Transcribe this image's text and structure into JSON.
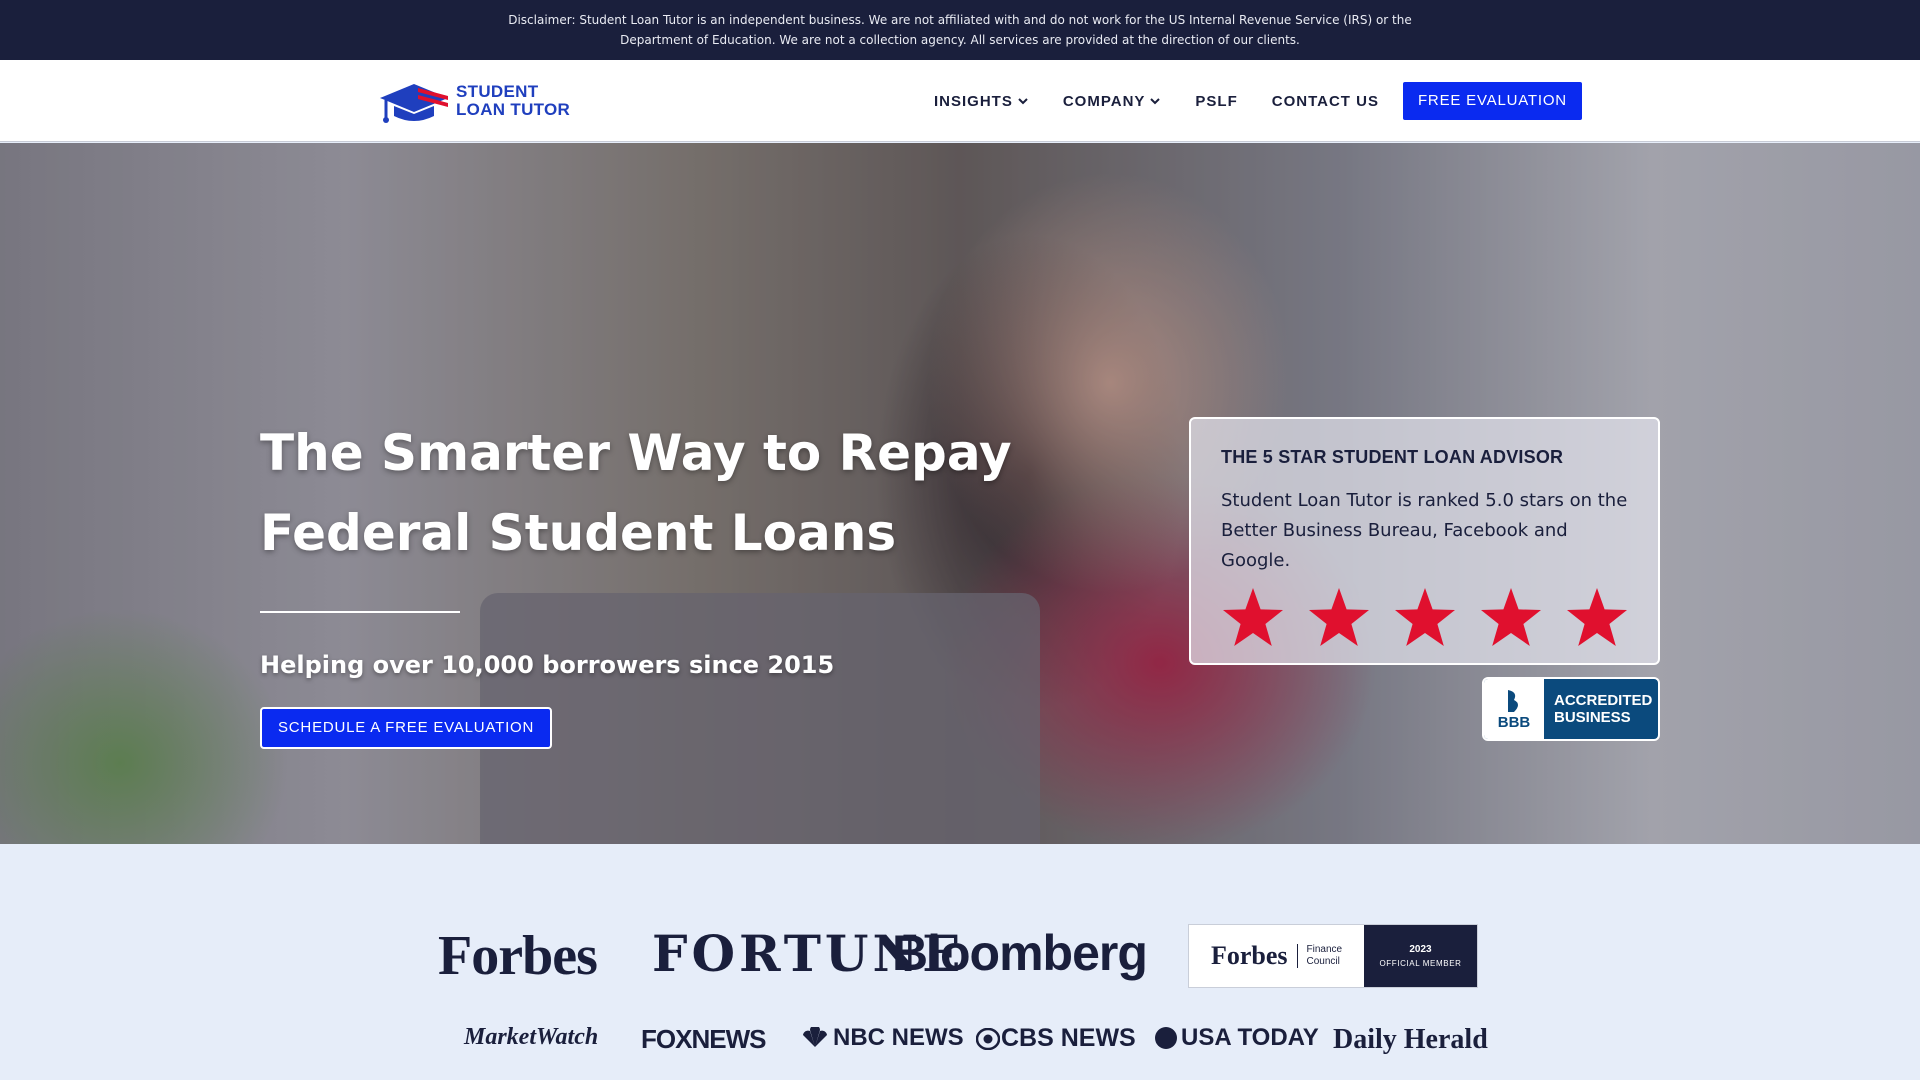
{
  "disclaimer": {
    "text": "Disclaimer: Student Loan Tutor is an independent business. We are not affiliated with and do not work for the US Internal Revenue Service (IRS) or the Department of Education. We are not a collection agency. All services are provided at the direction of our clients."
  },
  "header": {
    "logo_line1": "STUDENT",
    "logo_line2": "LOAN TUTOR",
    "nav": [
      {
        "label": "INSIGHTS",
        "has_dropdown": true
      },
      {
        "label": "COMPANY",
        "has_dropdown": true
      },
      {
        "label": "PSLF",
        "has_dropdown": false
      },
      {
        "label": "CONTACT US",
        "has_dropdown": false
      }
    ],
    "cta_label": "FREE EVALUATION"
  },
  "hero": {
    "title": "The Smarter Way to Repay Federal Student Loans",
    "subtitle": "Helping over 10,000 borrowers since 2015",
    "button_label": "SCHEDULE A FREE EVALUATION"
  },
  "rating": {
    "title": "THE 5 STAR STUDENT LOAN ADVISOR",
    "text": "Student Loan Tutor is ranked 5.0 stars on the Better Business Bureau, Facebook and Google.",
    "stars": 5
  },
  "bbb": {
    "seal_label": "BBB",
    "line1": "ACCREDITED",
    "line2": "BUSINESS"
  },
  "press": {
    "row1": [
      "Forbes",
      "FORTUNE",
      "Bloomberg"
    ],
    "forbes_council": {
      "brand": "Forbes",
      "line1": "Finance",
      "line2": "Council",
      "year": "2023",
      "badge": "OFFICIAL MEMBER"
    },
    "row2": [
      "MarketWatch",
      "FOXNEWS",
      "NBC NEWS",
      "CBS NEWS",
      "USA TODAY",
      "Daily Herald"
    ]
  },
  "colors": {
    "navy": "#1a1f3c",
    "brand_blue": "#0a2af0",
    "logo_blue": "#1f3fbe",
    "star_red": "#e0102e",
    "bbb_blue": "#0b4a7d",
    "press_bg": "#e6edf9"
  }
}
